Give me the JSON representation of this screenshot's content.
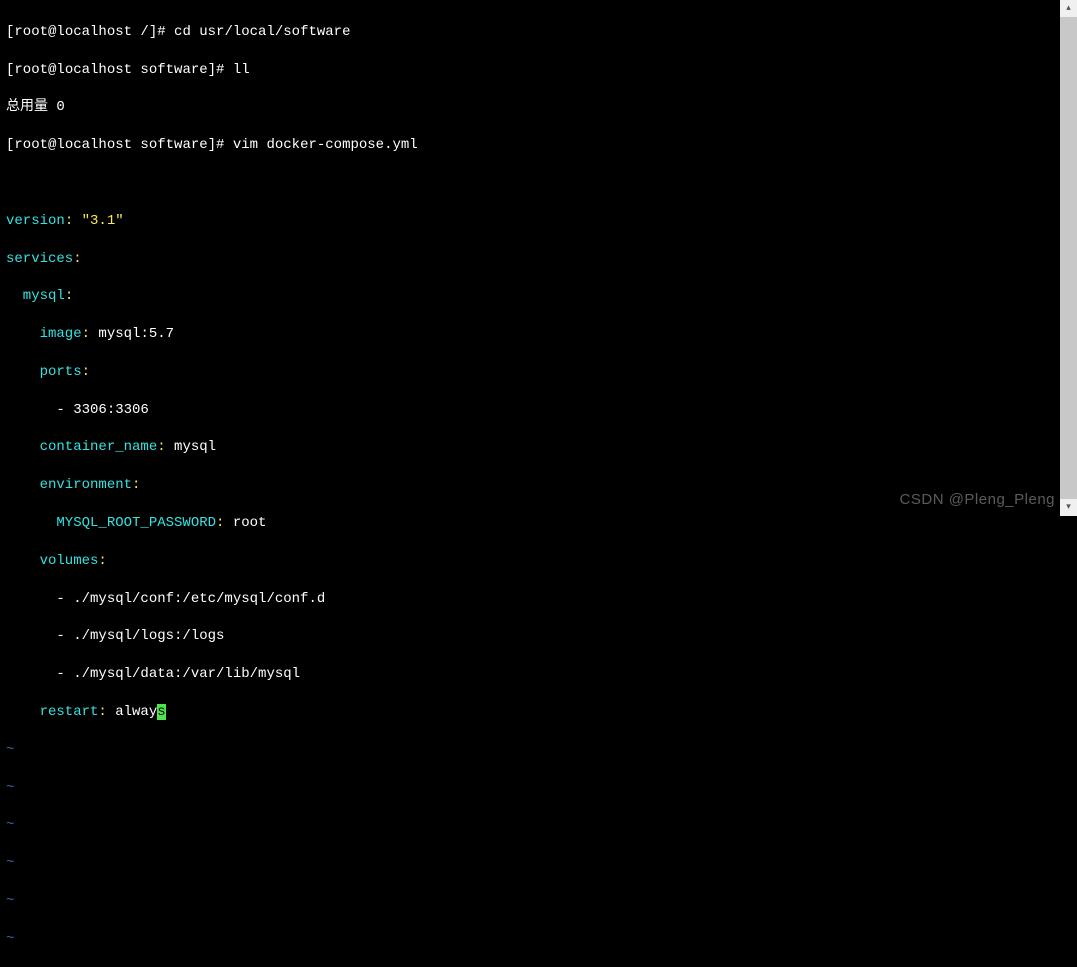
{
  "shell": {
    "line1_prompt_open": "[",
    "line1_user": "root@localhost",
    "line1_cwd": " /]# ",
    "line1_cmd": "cd usr/local/software",
    "line2_prompt_open": "[",
    "line2_user": "root@localhost",
    "line2_cwd": " software]# ",
    "line2_cmd": "ll",
    "line3": "总用量 0",
    "line4_prompt_open": "[",
    "line4_user": "root@localhost",
    "line4_cwd": " software]# ",
    "line4_cmd": "vim docker-compose.yml"
  },
  "yaml": {
    "version_key": "version",
    "colon": ":",
    "version_val": " \"3.1\"",
    "services_key": "services",
    "mysql_key": "  mysql",
    "image_key": "    image",
    "image_val": " mysql:5.7",
    "ports_key": "    ports",
    "ports_item": "      - 3306:3306",
    "container_key": "    container_name",
    "container_val": " mysql",
    "env_key": "    environment",
    "env_pwd_key": "      MYSQL_ROOT_PASSWORD",
    "env_pwd_val": " root",
    "volumes_key": "    volumes",
    "vol1": "      - ./mysql/conf:/etc/mysql/conf.d",
    "vol2": "      - ./mysql/logs:/logs",
    "vol3": "      - ./mysql/data:/var/lib/mysql",
    "restart_key": "    restart",
    "restart_val_part": " alway",
    "restart_val_cursor": "s"
  },
  "tilde": "~",
  "watermark": "CSDN @Pleng_Pleng"
}
